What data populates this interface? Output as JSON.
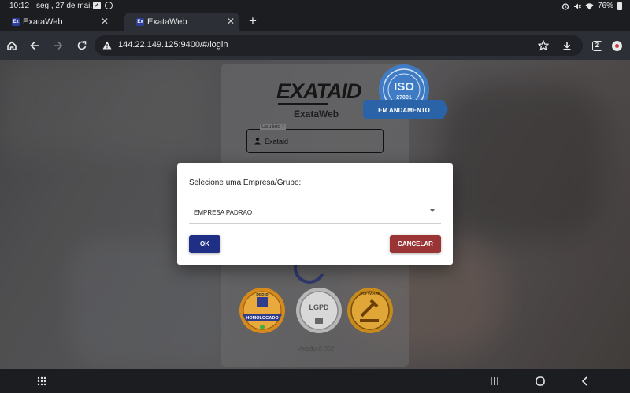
{
  "status_bar": {
    "time": "10:12",
    "date": "seg., 27 de mai.",
    "battery": "76%",
    "icons": [
      "check-icon",
      "sync-icon",
      "alarm-icon",
      "mute-icon",
      "wifi-icon",
      "battery-icon"
    ]
  },
  "tabs": [
    {
      "favicon": "Ex",
      "title": "ExataWeb",
      "active": false
    },
    {
      "favicon": "Ex",
      "title": "ExataWeb",
      "active": true
    }
  ],
  "toolbar": {
    "url": "144.22.149.125:9400/#/login",
    "tab_count": "2"
  },
  "login_card": {
    "brand": "EXATAID",
    "brand_sub": "ExataWeb",
    "iso_badge": {
      "text": "ISO",
      "number": "27001",
      "ribbon": "EM ANDAMENTO"
    },
    "user_field": {
      "label": "Usuário *",
      "value": "Exataid"
    },
    "seals": [
      {
        "name": "rep-p-seal",
        "line1": "REP-P",
        "line2": "HOMOLOGADO",
        "color": "#d68a1e"
      },
      {
        "name": "lgpd-seal",
        "line1": "LGPD",
        "line2": "",
        "color": "#b0b0b0"
      },
      {
        "name": "software-seal",
        "line1": "SOFTWARE",
        "line2": "",
        "color": "#c78a1c"
      }
    ],
    "version": "Versão 8.002"
  },
  "dialog": {
    "title": "Selecione uma Empresa/Grupo:",
    "selected_option": "EMPRESA PADRAO",
    "ok_label": "OK",
    "cancel_label": "CANCELAR"
  },
  "colors": {
    "ok_button": "#1f2f86",
    "cancel_button": "#9b3434"
  }
}
